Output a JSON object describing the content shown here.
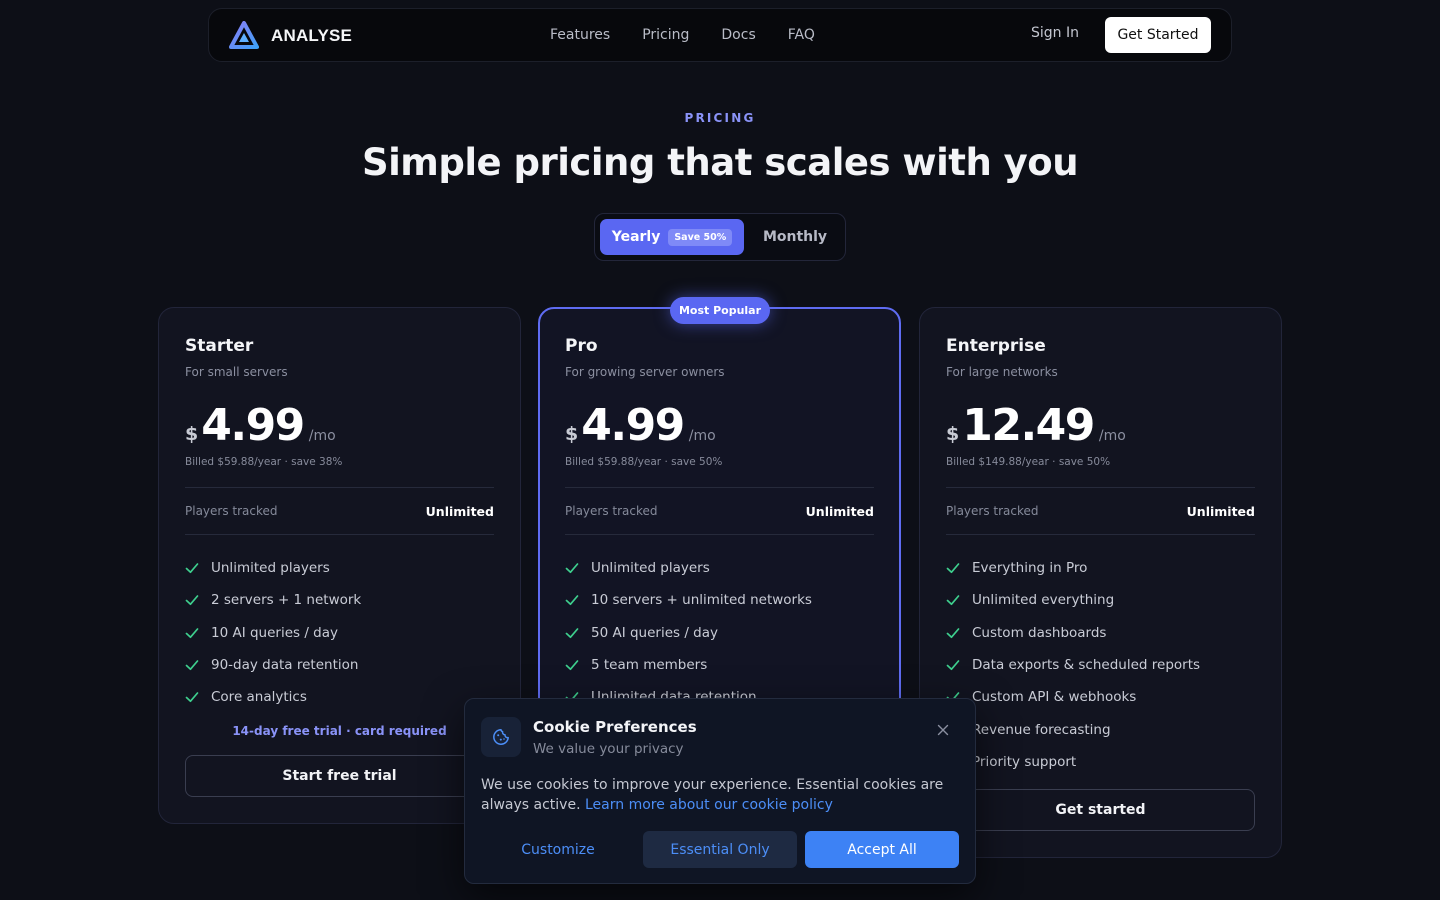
{
  "nav": {
    "brand": "ANALYSE",
    "links": [
      "Features",
      "Pricing",
      "Docs",
      "FAQ"
    ],
    "signin": "Sign In",
    "cta": "Get Started"
  },
  "header": {
    "eyebrow": "PRICING",
    "title": "Simple pricing that scales with you"
  },
  "toggle": {
    "yearly": "Yearly",
    "badge": "Save 50%",
    "monthly": "Monthly",
    "selected": "yearly"
  },
  "plans": [
    {
      "name": "Starter",
      "subtitle": "For small servers",
      "currency": "$",
      "price": "4.99",
      "period": "/mo",
      "billed": "Billed $59.88/year · save 38%",
      "meter_label": "Players tracked",
      "meter_value": "Unlimited",
      "features": [
        "Unlimited players",
        "2 servers + 1 network",
        "10 AI queries / day",
        "90-day data retention",
        "Core analytics"
      ],
      "note": "14-day free trial · card required",
      "button": "Start free trial"
    },
    {
      "name": "Pro",
      "badge": "Most Popular",
      "subtitle": "For growing server owners",
      "currency": "$",
      "price": "4.99",
      "period": "/mo",
      "billed": "Billed $59.88/year · save 50%",
      "meter_label": "Players tracked",
      "meter_value": "Unlimited",
      "features": [
        "Unlimited players",
        "10 servers + unlimited networks",
        "50 AI queries / day",
        "5 team members",
        "Unlimited data retention"
      ]
    },
    {
      "name": "Enterprise",
      "subtitle": "For large networks",
      "currency": "$",
      "price": "12.49",
      "period": "/mo",
      "billed": "Billed $149.88/year · save 50%",
      "meter_label": "Players tracked",
      "meter_value": "Unlimited",
      "features": [
        "Everything in Pro",
        "Unlimited everything",
        "Custom dashboards",
        "Data exports & scheduled reports",
        "Custom API & webhooks",
        "Revenue forecasting",
        "Priority support"
      ],
      "button": "Get started"
    }
  ],
  "cookie": {
    "title": "Cookie Preferences",
    "subtitle": "We value your privacy",
    "body": "We use cookies to improve your experience. Essential cookies are always active.",
    "link": "Learn more about our cookie policy",
    "customize": "Customize",
    "essential": "Essential Only",
    "accept": "Accept All"
  },
  "colors": {
    "accent": "#5a67f2",
    "check": "#3ecf8e",
    "link": "#4c8ef7",
    "background": "#0d0f17"
  }
}
